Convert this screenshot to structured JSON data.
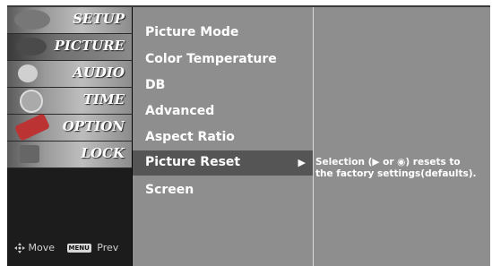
{
  "tabs": [
    {
      "label": "SETUP"
    },
    {
      "label": "PICTURE"
    },
    {
      "label": "AUDIO"
    },
    {
      "label": "TIME"
    },
    {
      "label": "OPTION"
    },
    {
      "label": "LOCK"
    }
  ],
  "selected_tab": "PICTURE",
  "hint": {
    "move_label": "Move",
    "menu_key": "MENU",
    "prev_label": "Prev"
  },
  "menu": {
    "items": [
      {
        "label": "Picture Mode"
      },
      {
        "label": "Color Temperature"
      },
      {
        "label": "DB"
      },
      {
        "label": "Advanced"
      },
      {
        "label": "Aspect Ratio"
      },
      {
        "label": "Picture Reset"
      },
      {
        "label": "Screen"
      }
    ],
    "selected_item": "Picture Reset",
    "arrow": "▶"
  },
  "info": {
    "line1": "Selection (▶ or ◉) resets to",
    "line2": "the factory settings(defaults)."
  },
  "colors": {
    "panel": "#8e8e8e",
    "highlight": "#555555",
    "tab_bg": "#1c1c1c"
  }
}
